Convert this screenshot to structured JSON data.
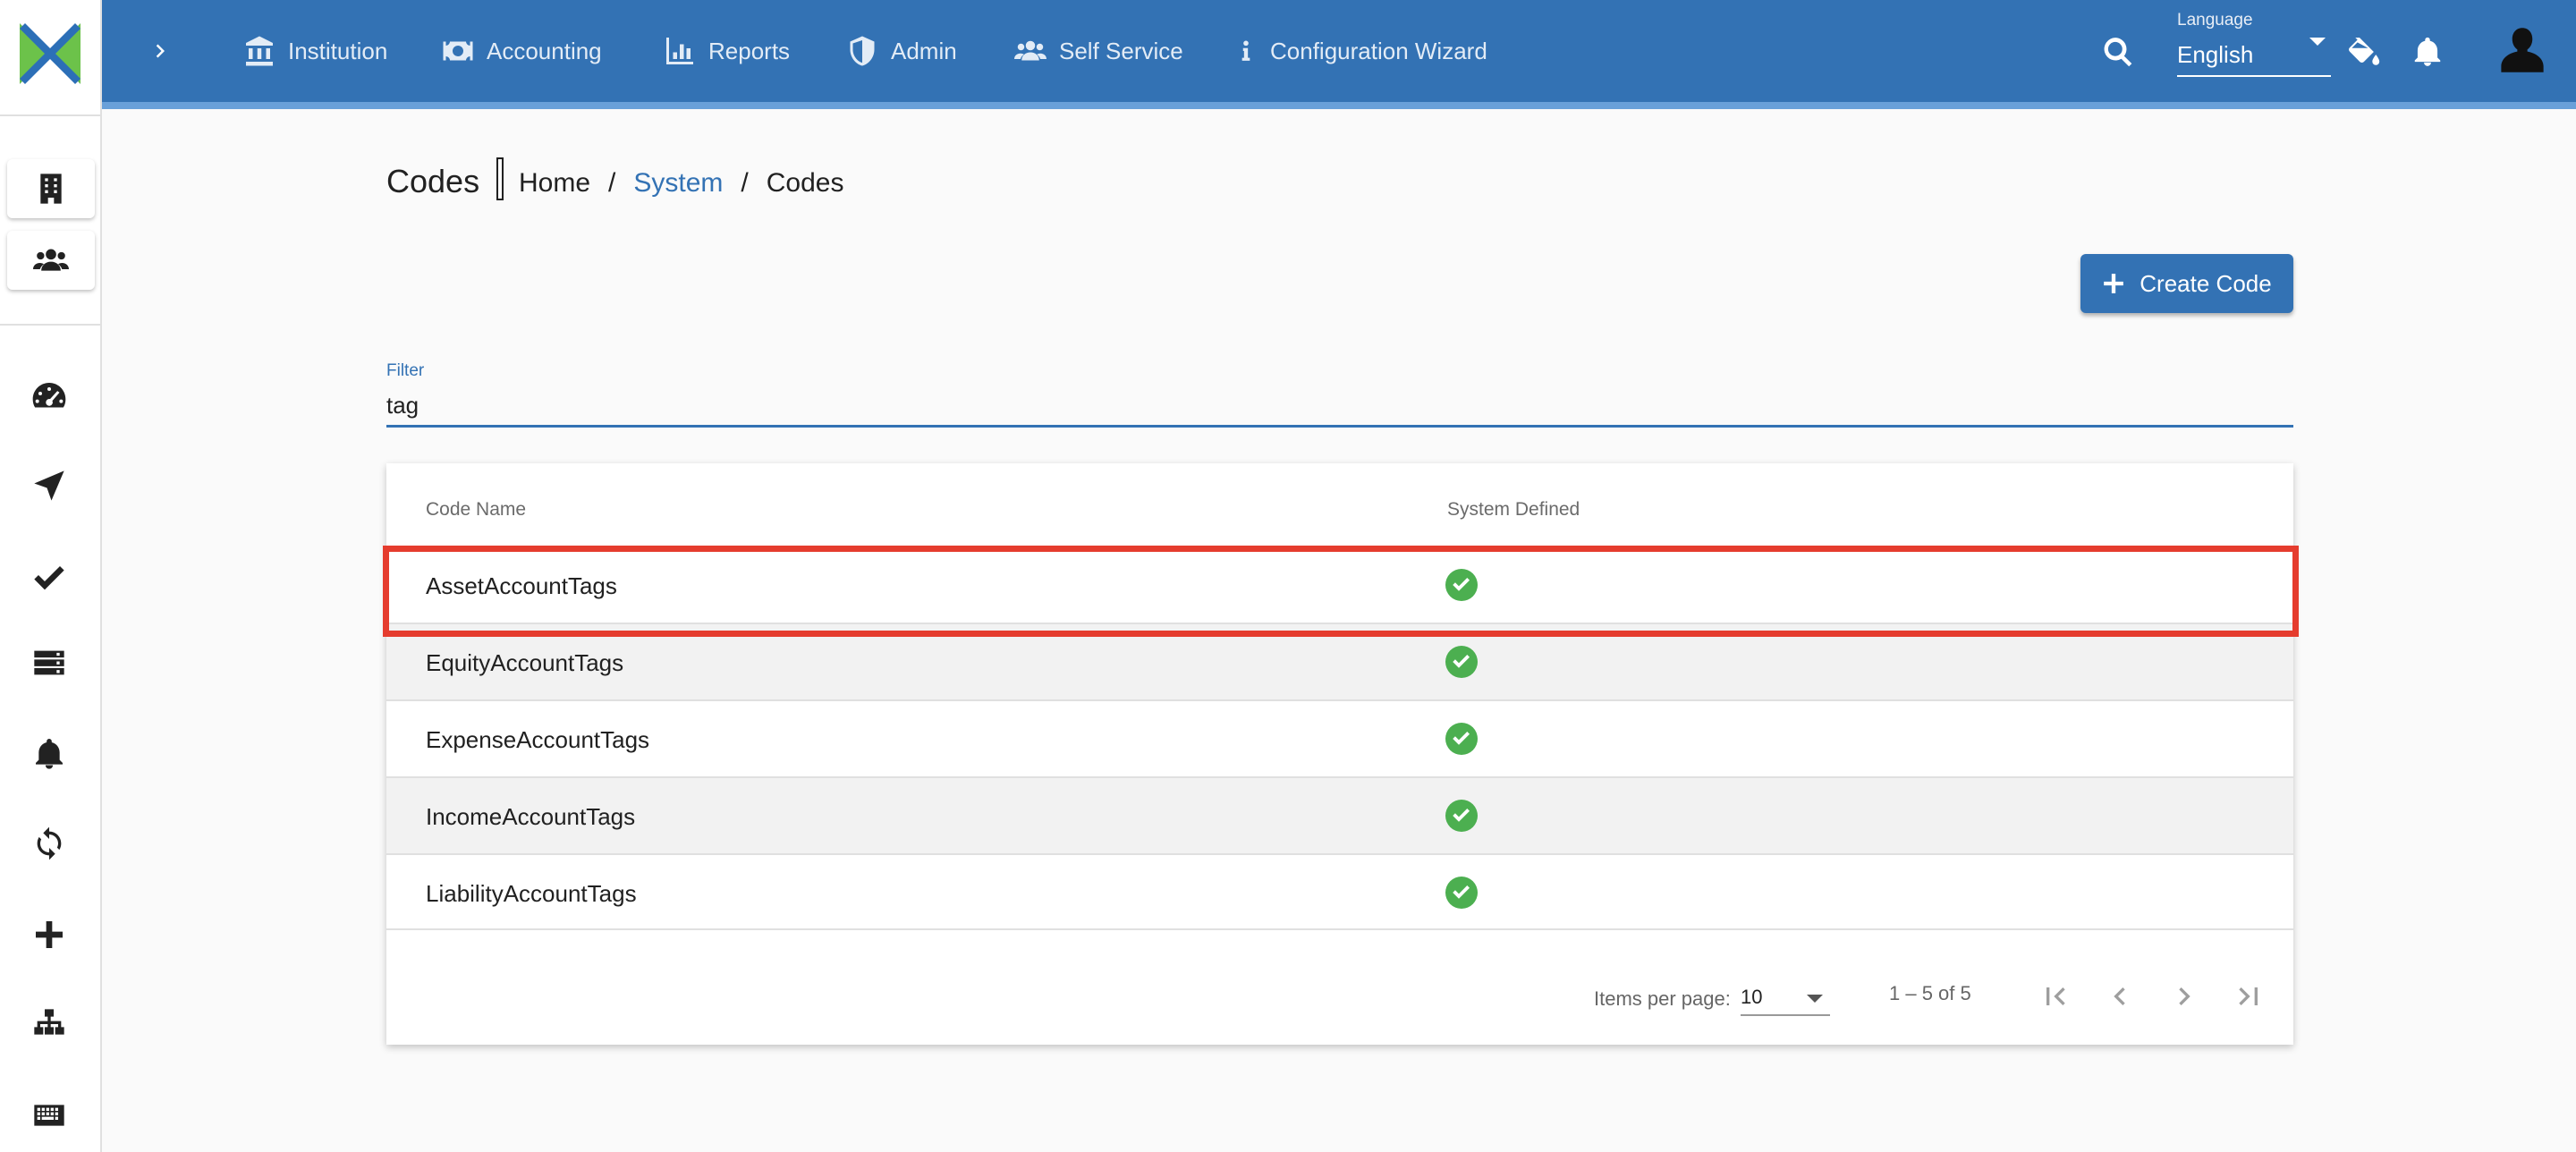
{
  "colors": {
    "primary": "#3372b4",
    "highlight": "#e53c2e",
    "check": "#4caf50"
  },
  "sidebar": {
    "logo_icon": "app-logo",
    "top_items": [
      {
        "icon": "building-icon"
      },
      {
        "icon": "users-icon"
      }
    ],
    "items": [
      {
        "icon": "dashboard-icon"
      },
      {
        "icon": "navigate-icon"
      },
      {
        "icon": "check-icon"
      },
      {
        "icon": "server-icon"
      },
      {
        "icon": "bell-icon"
      },
      {
        "icon": "sync-icon"
      },
      {
        "icon": "plus-icon"
      },
      {
        "icon": "sitemap-icon"
      },
      {
        "icon": "keyboard-icon"
      }
    ]
  },
  "toolbar": {
    "nav": [
      {
        "label": "Institution",
        "icon": "institution-icon"
      },
      {
        "label": "Accounting",
        "icon": "money-icon"
      },
      {
        "label": "Reports",
        "icon": "chart-icon"
      },
      {
        "label": "Admin",
        "icon": "shield-icon"
      },
      {
        "label": "Self Service",
        "icon": "users-icon"
      },
      {
        "label": "Configuration Wizard",
        "icon": "info-icon"
      }
    ],
    "language_label": "Language",
    "language_value": "English"
  },
  "page": {
    "title": "Codes",
    "breadcrumb": [
      "Home",
      "System",
      "Codes"
    ],
    "create_button": "Create Code"
  },
  "filter": {
    "label": "Filter",
    "value": "tag"
  },
  "table": {
    "headers": [
      "Code Name",
      "System Defined"
    ],
    "rows": [
      {
        "name": "AssetAccountTags",
        "system_defined": true
      },
      {
        "name": "EquityAccountTags",
        "system_defined": true
      },
      {
        "name": "ExpenseAccountTags",
        "system_defined": true
      },
      {
        "name": "IncomeAccountTags",
        "system_defined": true
      },
      {
        "name": "LiabilityAccountTags",
        "system_defined": true
      }
    ]
  },
  "paginator": {
    "items_per_page_label": "Items per page:",
    "items_per_page": "10",
    "range": "1 – 5 of 5"
  }
}
